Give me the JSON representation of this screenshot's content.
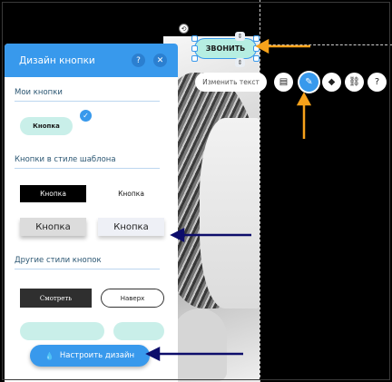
{
  "panel": {
    "title": "Дизайн кнопки",
    "help_icon": "?",
    "close_icon": "✕",
    "section_mine": "Мои кнопки",
    "my_button_label": "Кнопка",
    "section_template": "Кнопки в стиле шаблона",
    "template_buttons": [
      "Кнопка",
      "Кнопка",
      "Кнопка",
      "Кнопка"
    ],
    "section_other": "Другие стили кнопок",
    "other_buttons": [
      "Смотреть",
      "Наверх"
    ],
    "customize_label": "Настроить дизайн"
  },
  "canvas": {
    "call_button_label": "ЗВОНИТЬ"
  },
  "toolbar": {
    "edit_text_label": "Изменить текст",
    "tools": [
      "layout-icon",
      "brush-icon",
      "animation-icon",
      "link-icon",
      "help-icon"
    ]
  },
  "colors": {
    "accent": "#3899ec",
    "mint": "#c9efe9",
    "arrow_orange": "#f7a21b",
    "arrow_navy": "#0d0d6b"
  }
}
